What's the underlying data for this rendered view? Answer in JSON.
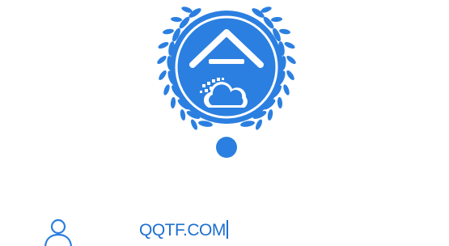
{
  "colors": {
    "brand": "#2b7fe0",
    "text_accent": "#1e6fd0",
    "icon": "#2b7fe0"
  },
  "logo": {
    "icon": "laurel-emblem-cloud-icon"
  },
  "login": {
    "user_icon": "user-icon",
    "account_value": "QQTF.COM"
  }
}
